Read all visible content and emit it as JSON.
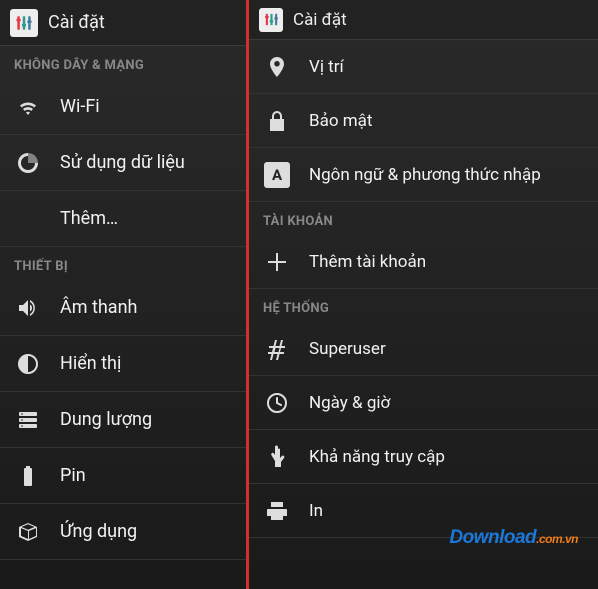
{
  "app_title": "Cài đặt",
  "left": {
    "sections": [
      {
        "header": "KHÔNG DÂY & MẠNG",
        "items": [
          {
            "icon": "wifi",
            "label": "Wi-Fi"
          },
          {
            "icon": "data-usage",
            "label": "Sử dụng dữ liệu"
          },
          {
            "icon": "",
            "label": "Thêm…"
          }
        ]
      },
      {
        "header": "THIẾT BỊ",
        "items": [
          {
            "icon": "sound",
            "label": "Âm thanh"
          },
          {
            "icon": "display",
            "label": "Hiển thị"
          },
          {
            "icon": "storage",
            "label": "Dung lượng"
          },
          {
            "icon": "battery",
            "label": "Pin"
          },
          {
            "icon": "apps",
            "label": "Ứng dụng"
          }
        ]
      }
    ]
  },
  "right": {
    "preItems": [
      {
        "icon": "location",
        "label": "Vị trí"
      },
      {
        "icon": "lock",
        "label": "Bảo mật"
      },
      {
        "icon": "language",
        "label": "Ngôn ngữ & phương thức nhập"
      }
    ],
    "sections": [
      {
        "header": "TÀI KHOẢN",
        "items": [
          {
            "icon": "plus",
            "label": "Thêm tài khoản"
          }
        ]
      },
      {
        "header": "HỆ THỐNG",
        "items": [
          {
            "icon": "hash",
            "label": "Superuser"
          },
          {
            "icon": "clock",
            "label": "Ngày & giờ"
          },
          {
            "icon": "hand",
            "label": "Khả năng truy cập"
          },
          {
            "icon": "print",
            "label": "In"
          }
        ]
      }
    ]
  },
  "watermark": {
    "part1": "Download",
    "part2": ".com.vn"
  }
}
